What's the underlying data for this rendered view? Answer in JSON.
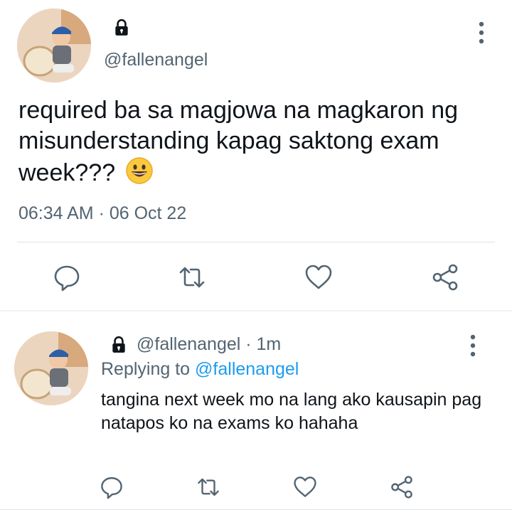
{
  "main_tweet": {
    "handle": "@fallenangel",
    "text": "required ba sa magjowa na magkaron ng misunderstanding kapag saktong exam week???",
    "emoji": "grinning-face",
    "timestamp": "06:34 AM · 06 Oct 22",
    "icons": {
      "lock": "lock-icon",
      "more": "more-vertical-icon",
      "reply": "reply-icon",
      "retweet": "retweet-icon",
      "like": "heart-icon",
      "share": "share-icon"
    }
  },
  "reply_tweet": {
    "handle_and_time": "@fallenangel · 1m",
    "replying_to_prefix": "Replying to",
    "replying_to_mention": "@fallenangel",
    "text": "tangina next week mo na lang ako kausapin pag natapos ko na exams ko hahaha"
  },
  "colors": {
    "text": "#0f1419",
    "secondary": "#536471",
    "mention": "#1d9bf0",
    "divider": "#dfe3e6"
  }
}
